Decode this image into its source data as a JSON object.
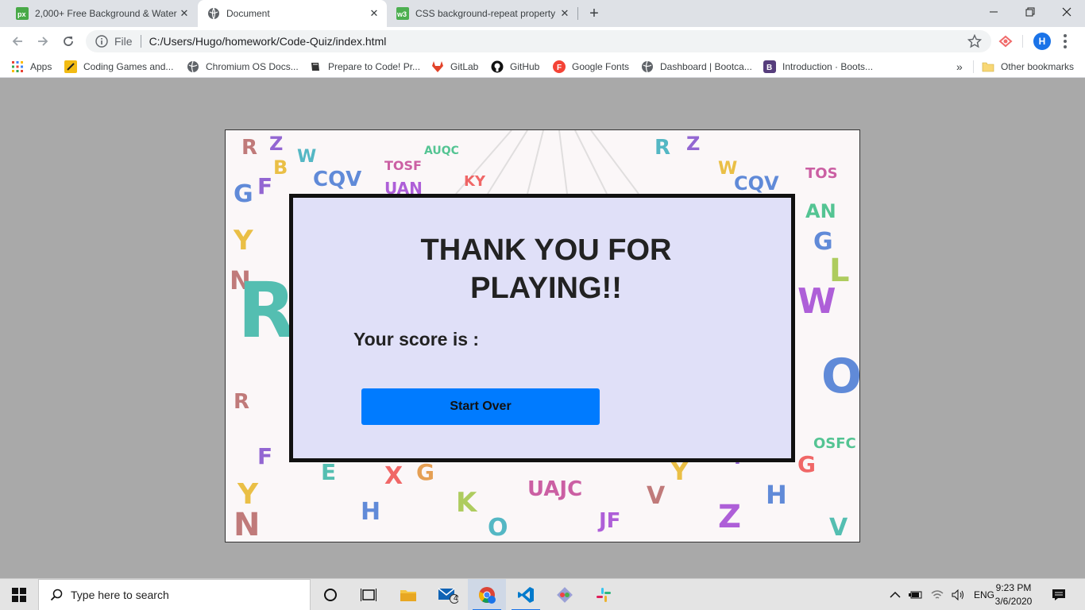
{
  "browser": {
    "tabs": [
      {
        "title": "2,000+ Free Background & Water",
        "favicon": "pixabay-icon",
        "active": false
      },
      {
        "title": "Document",
        "favicon": "globe-icon",
        "active": true
      },
      {
        "title": "CSS background-repeat property",
        "favicon": "w3schools-icon",
        "active": false
      }
    ],
    "scheme_label": "File",
    "url": "C:/Users/Hugo/homework/Code-Quiz/index.html",
    "profile_initial": "H"
  },
  "bookmarks": {
    "apps_label": "Apps",
    "items": [
      {
        "label": "Coding Games and...",
        "icon": "codingame-icon"
      },
      {
        "label": "Chromium OS Docs...",
        "icon": "globe-icon"
      },
      {
        "label": "Prepare to Code! Pr...",
        "icon": "book-icon"
      },
      {
        "label": "GitLab",
        "icon": "gitlab-icon"
      },
      {
        "label": "GitHub",
        "icon": "github-icon"
      },
      {
        "label": "Google Fonts",
        "icon": "google-fonts-icon"
      },
      {
        "label": "Dashboard | Bootca...",
        "icon": "globe-icon"
      },
      {
        "label": "Introduction · Boots...",
        "icon": "bootstrap-icon"
      }
    ],
    "overflow": "»",
    "other_label": "Other bookmarks"
  },
  "page": {
    "title": "THANK YOU FOR PLAYING!!",
    "score_label": "Your score is :",
    "button_label": "Start Over",
    "colors": {
      "page_bg": "#a9a9a9",
      "card_bg": "#e0e0f8",
      "button_bg": "#007bff"
    }
  },
  "taskbar": {
    "search_placeholder": "Type here to search",
    "mail_badge": "4",
    "language": "ENG",
    "time": "9:23 PM",
    "date": "3/6/2020"
  }
}
